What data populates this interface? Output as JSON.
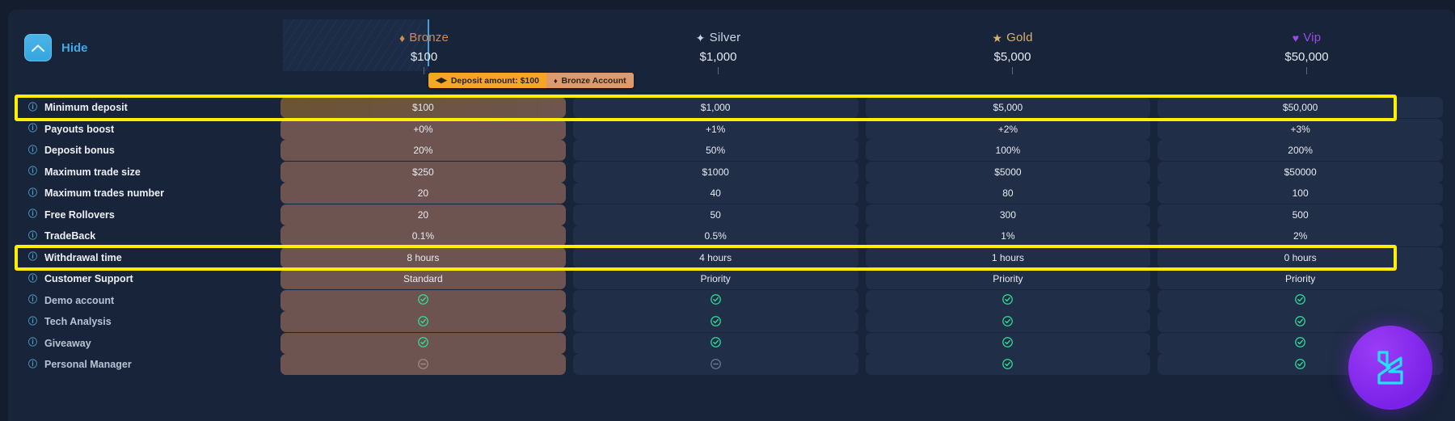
{
  "toolbar": {
    "hide_label": "Hide",
    "hide_icon": "chevron-up-icon"
  },
  "colors": {
    "panel_bg": "#18243a",
    "page_bg": "#141d2e",
    "accent_blue": "#3fa9e6",
    "highlight_yellow": "#ffee00",
    "bronze_row": "#6e5450",
    "check_green": "#2ee09a",
    "badge_orange": "#f5a623",
    "badge_tan": "#dd9a6f",
    "logo_purple": "#7b22e8",
    "logo_cyan": "#22e0ff"
  },
  "tiers": [
    {
      "name": "Bronze",
      "price": "$100",
      "glyph": "♦",
      "glyph_name": "diamond-icon",
      "color": "#d08b54"
    },
    {
      "name": "Silver",
      "price": "$1,000",
      "glyph": "✦",
      "glyph_name": "sparkle-icon",
      "color": "#cdd5e2"
    },
    {
      "name": "Gold",
      "price": "$5,000",
      "glyph": "★",
      "glyph_name": "star-icon",
      "color": "#d9b36a"
    },
    {
      "name": "Vip",
      "price": "$50,000",
      "glyph": "♥",
      "glyph_name": "heart-icon",
      "color": "#9b4ae8"
    }
  ],
  "badge": {
    "deposit_glyph": "◀▶",
    "deposit_text": "Deposit amount: $100",
    "account_glyph": "♦",
    "account_text": "Bronze Account"
  },
  "rows": [
    {
      "label": "Minimum deposit",
      "highlight": true,
      "dim": false,
      "values": [
        "$100",
        "$1,000",
        "$5,000",
        "$50,000"
      ]
    },
    {
      "label": "Payouts boost",
      "highlight": false,
      "dim": false,
      "values": [
        "+0%",
        "+1%",
        "+2%",
        "+3%"
      ]
    },
    {
      "label": "Deposit bonus",
      "highlight": false,
      "dim": false,
      "values": [
        "20%",
        "50%",
        "100%",
        "200%"
      ]
    },
    {
      "label": "Maximum trade size",
      "highlight": false,
      "dim": false,
      "values": [
        "$250",
        "$1000",
        "$5000",
        "$50000"
      ]
    },
    {
      "label": "Maximum trades number",
      "highlight": false,
      "dim": false,
      "values": [
        "20",
        "40",
        "80",
        "100"
      ]
    },
    {
      "label": "Free Rollovers",
      "highlight": false,
      "dim": false,
      "values": [
        "20",
        "50",
        "300",
        "500"
      ]
    },
    {
      "label": "TradeBack",
      "highlight": false,
      "dim": false,
      "values": [
        "0.1%",
        "0.5%",
        "1%",
        "2%"
      ]
    },
    {
      "label": "Withdrawal time",
      "highlight": true,
      "dim": false,
      "values": [
        "8 hours",
        "4 hours",
        "1 hours",
        "0 hours"
      ]
    },
    {
      "label": "Customer Support",
      "highlight": false,
      "dim": false,
      "values": [
        "Standard",
        "Priority",
        "Priority",
        "Priority"
      ]
    },
    {
      "label": "Demo account",
      "highlight": false,
      "dim": true,
      "values": [
        "check",
        "check",
        "check",
        "check"
      ]
    },
    {
      "label": "Tech Analysis",
      "highlight": false,
      "dim": true,
      "values": [
        "check",
        "check",
        "check",
        "check"
      ]
    },
    {
      "label": "Giveaway",
      "highlight": false,
      "dim": true,
      "values": [
        "check",
        "check",
        "check",
        "check"
      ]
    },
    {
      "label": "Personal Manager",
      "highlight": false,
      "dim": true,
      "values": [
        "dash",
        "dash",
        "check",
        "check"
      ]
    }
  ],
  "icons": {
    "info": "ⓘ",
    "check": "✔",
    "dash": "⊖",
    "row_info_name": "info-icon"
  },
  "logo": {
    "name": "brand-logo",
    "letter": "L"
  }
}
